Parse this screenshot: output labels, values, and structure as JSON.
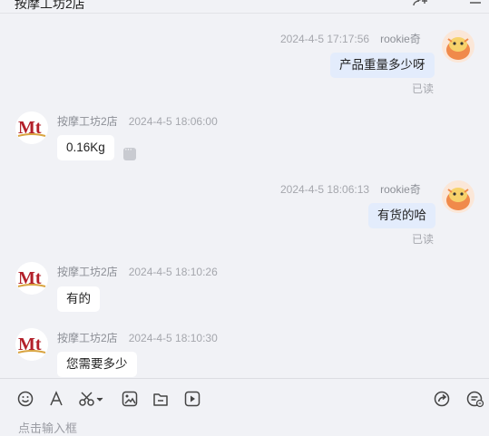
{
  "header": {
    "title": "按摩工坊2店"
  },
  "messages": [
    {
      "side": "right",
      "sender": "rookie奇",
      "time": "2024-4-5 17:17:56",
      "text": "产品重量多少呀",
      "status": "已读"
    },
    {
      "side": "left",
      "sender": "按摩工坊2店",
      "time": "2024-4-5 18:06:00",
      "text": "0.16Kg"
    },
    {
      "side": "right",
      "sender": "rookie奇",
      "time": "2024-4-5 18:06:13",
      "text": "有货的哈",
      "status": "已读"
    },
    {
      "side": "left",
      "sender": "按摩工坊2店",
      "time": "2024-4-5 18:10:26",
      "text": "有的"
    },
    {
      "side": "left",
      "sender": "按摩工坊2店",
      "time": "2024-4-5 18:10:30",
      "text": "您需要多少"
    }
  ],
  "shop_logo_text": "Mt",
  "toolbar": {
    "left_icons": [
      "emoji-icon",
      "font-icon",
      "scissors-icon",
      "image-icon",
      "folder-icon",
      "video-icon"
    ],
    "right_icons": [
      "share-icon",
      "quick-reply-icon"
    ]
  },
  "input": {
    "placeholder": "点击输入框"
  },
  "colors": {
    "background": "#f1f2f6",
    "outgoing_bubble": "#e3ecfc",
    "incoming_bubble": "#ffffff",
    "logo_red": "#b3202a",
    "avatar_orange": "#f08a4b"
  }
}
